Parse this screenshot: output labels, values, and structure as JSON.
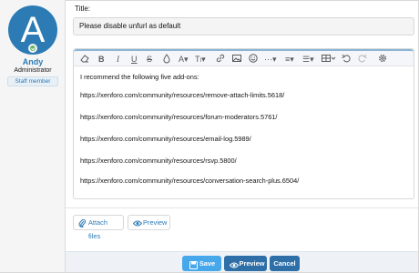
{
  "user": {
    "avatar_letter": "A",
    "name": "Andy",
    "title": "Administrator",
    "badge": "Staff member"
  },
  "form": {
    "title_label": "Title:",
    "title_value": "Please disable unfurl as default"
  },
  "editor": {
    "toolbar_icons": [
      "eraser-icon",
      "bold-icon",
      "italic-icon",
      "underline-icon",
      "strikethrough-icon",
      "text-color-icon",
      "font-family-icon",
      "font-size-icon",
      "link-icon",
      "image-icon",
      "smilie-icon",
      "more-options-icon",
      "align-icon",
      "list-icon",
      "table-icon",
      "undo-icon",
      "redo-icon",
      "settings-icon"
    ],
    "lines": [
      "I recommend the following five add-ons:",
      "https://xenforo.com/community/resources/remove-attach-limits.5618/",
      "https://xenforo.com/community/resources/forum-moderators.5761/",
      "https://xenforo.com/community/resources/email-log.5989/",
      "https://xenforo.com/community/resources/rsvp.5800/",
      "https://xenforo.com/community/resources/conversation-search-plus.6504/"
    ]
  },
  "attachments": {
    "attach_label": "Attach files",
    "preview_label": "Preview"
  },
  "footer": {
    "save_label": "Save",
    "preview_label": "Preview",
    "cancel_label": "Cancel"
  },
  "colors": {
    "accent": "#2c7bb5",
    "save_button": "#47a7eb",
    "online": "#63b265"
  }
}
